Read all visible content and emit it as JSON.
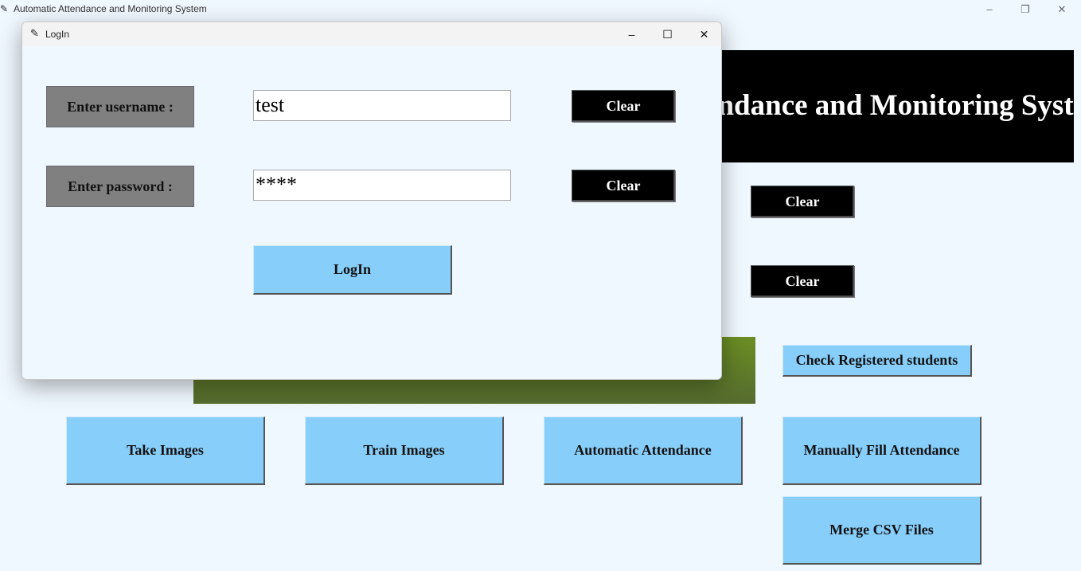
{
  "main_window": {
    "title": "Automatic Attendance and Monitoring System",
    "controls": {
      "minimize": "–",
      "restore": "❐",
      "close": "✕"
    },
    "banner_text": "Automatic Attendance and Monitoring System",
    "clear_button_1": "Clear",
    "clear_button_2": "Clear",
    "check_registered_label": "Check Registered students",
    "take_images_label": "Take Images",
    "train_images_label": "Train Images",
    "automatic_attendance_label": "Automatic Attendance",
    "manual_attendance_label": "Manually Fill Attendance",
    "merge_csv_label": "Merge CSV Files"
  },
  "login_dialog": {
    "title": "LogIn",
    "controls": {
      "minimize": "–",
      "maximize": "☐",
      "close": "✕"
    },
    "username_label": "Enter username :",
    "username_value": "test",
    "password_label": "Enter password :",
    "password_value": "****",
    "clear_username_label": "Clear",
    "clear_password_label": "Clear",
    "login_button_label": "LogIn"
  },
  "colors": {
    "background": "#f0f8ff",
    "button_blue": "#87cefa",
    "button_black": "#000000",
    "label_gray": "#808080",
    "panel_green": "#6b8e23"
  },
  "icons": {
    "app_icon": "feather-icon"
  }
}
